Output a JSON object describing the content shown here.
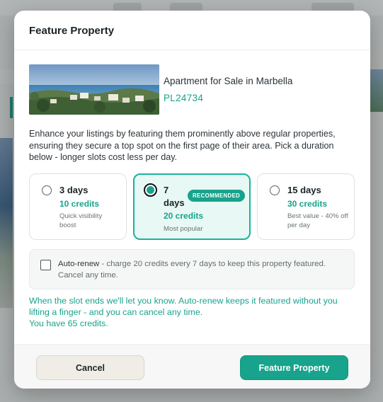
{
  "modal": {
    "title": "Feature Property"
  },
  "property": {
    "name": "Apartment for Sale in Marbella",
    "reference": "PL24734"
  },
  "description": "Enhance your listings by featuring them prominently above regular properties, ensuring they secure a top spot on the first page of their area. Pick a duration below - longer slots cost less per day.",
  "options": [
    {
      "days": "3 days",
      "credits": "10 credits",
      "note": "Quick visibility boost",
      "selected": false
    },
    {
      "days": "7 days",
      "credits": "20 credits",
      "note": "Most popular",
      "badge": "RECOMMENDED",
      "selected": true
    },
    {
      "days": "15 days",
      "credits": "30 credits",
      "note": "Best value - 40% off per day",
      "selected": false
    }
  ],
  "autorenew": {
    "checked": false,
    "label": "Auto-renew",
    "text": " - charge 20 credits every 7 days to keep this property featured. Cancel any time."
  },
  "info": {
    "line1": "When the slot ends we'll let you know. Auto-renew keeps it featured without you lifting a finger - and you can cancel any time.",
    "line2": "You have 65 credits."
  },
  "footer": {
    "cancel_label": "Cancel",
    "feature_label": "Feature Property"
  },
  "colors": {
    "accent": "#17a38c",
    "selected_bg": "#e8f8f4",
    "cancel_bg": "#efede6"
  }
}
